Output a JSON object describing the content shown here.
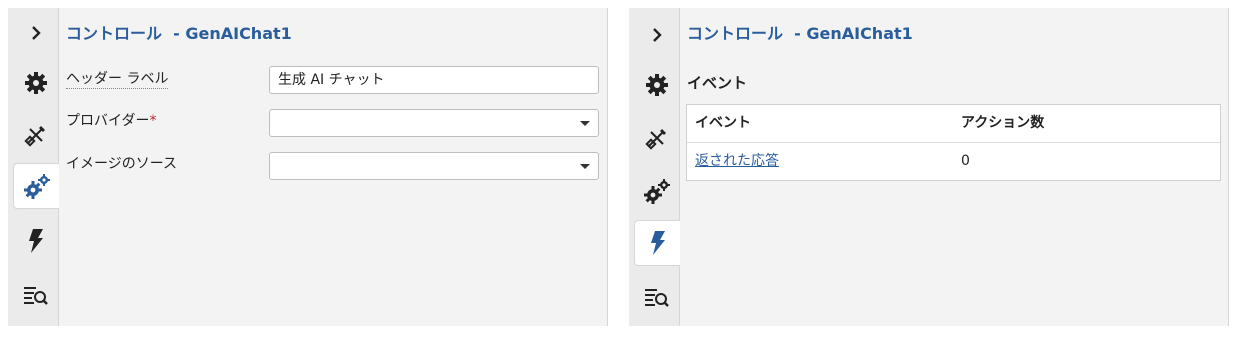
{
  "colors": {
    "accent": "#2a5d9c",
    "required": "#c0272d",
    "panel_bg": "#f3f3f3"
  },
  "left_panel": {
    "title": "コントロール  - GenAIChat1",
    "rail": {
      "items": [
        {
          "name": "expand",
          "icon": "chevron-right-icon"
        },
        {
          "name": "settings",
          "icon": "gear-icon"
        },
        {
          "name": "design",
          "icon": "pencil-ruler-icon"
        },
        {
          "name": "advanced",
          "icon": "gears-icon",
          "active": true
        },
        {
          "name": "events",
          "icon": "lightning-icon"
        },
        {
          "name": "search",
          "icon": "list-search-icon"
        }
      ]
    },
    "form": {
      "header_label": {
        "label": "ヘッダー ラベル",
        "value": "生成 AI チャット"
      },
      "provider": {
        "label": "プロバイダー",
        "required_mark": "*",
        "value": ""
      },
      "image_source": {
        "label": "イメージのソース",
        "value": ""
      }
    }
  },
  "right_panel": {
    "title": "コントロール  - GenAIChat1",
    "rail": {
      "items": [
        {
          "name": "expand",
          "icon": "chevron-right-icon"
        },
        {
          "name": "settings",
          "icon": "gear-icon"
        },
        {
          "name": "design",
          "icon": "pencil-ruler-icon"
        },
        {
          "name": "advanced",
          "icon": "gears-icon"
        },
        {
          "name": "events",
          "icon": "lightning-icon",
          "active": true
        },
        {
          "name": "search",
          "icon": "list-search-icon"
        }
      ]
    },
    "events": {
      "heading": "イベント",
      "columns": [
        "イベント",
        "アクション数"
      ],
      "rows": [
        {
          "event": "返された応答",
          "count": "0"
        }
      ]
    }
  }
}
